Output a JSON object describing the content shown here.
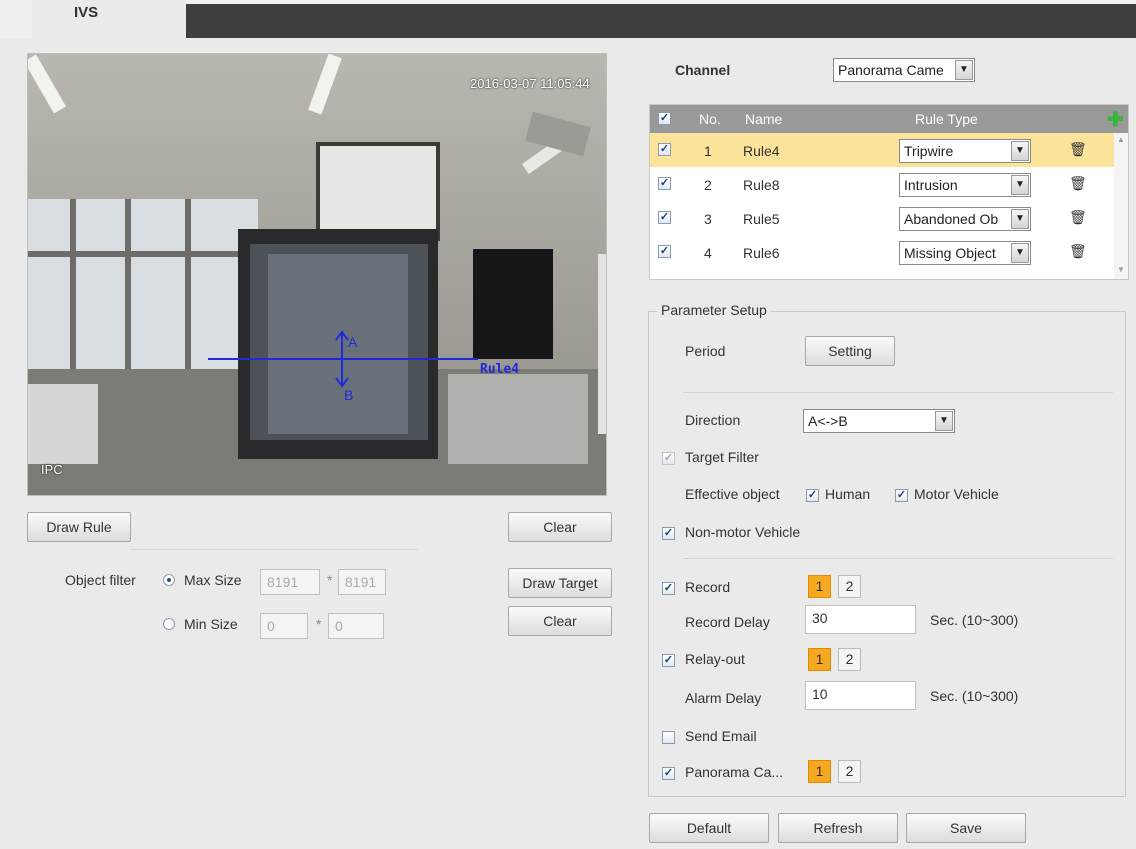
{
  "tab": {
    "label": "IVS"
  },
  "video": {
    "timestamp": "2016-03-07 11:05:44",
    "channel_label": "IPC",
    "rule_overlay_name": "Rule4",
    "direction_a": "A",
    "direction_b": "B"
  },
  "left_controls": {
    "draw_rule": "Draw Rule",
    "clear_rule": "Clear",
    "object_filter_label": "Object filter",
    "max_size_label": "Max Size",
    "max_w": "8191",
    "max_h": "8191",
    "min_size_label": "Min Size",
    "min_w": "0",
    "min_h": "0",
    "times": "*",
    "draw_target": "Draw Target",
    "clear_target": "Clear"
  },
  "channel": {
    "label": "Channel",
    "value": "Panorama Came"
  },
  "rules": {
    "headers": {
      "no": "No.",
      "name": "Name",
      "rule_type": "Rule Type"
    },
    "rows": [
      {
        "no": "1",
        "name": "Rule4",
        "type": "Tripwire",
        "selected": true
      },
      {
        "no": "2",
        "name": "Rule8",
        "type": "Intrusion",
        "selected": false
      },
      {
        "no": "3",
        "name": "Rule5",
        "type": "Abandoned Ob",
        "selected": false
      },
      {
        "no": "4",
        "name": "Rule6",
        "type": "Missing Object",
        "selected": false
      }
    ]
  },
  "params": {
    "legend": "Parameter Setup",
    "period_label": "Period",
    "setting_button": "Setting",
    "direction_label": "Direction",
    "direction_value": "A<->B",
    "target_filter": "Target Filter",
    "effective_object": "Effective object",
    "human": "Human",
    "motor_vehicle": "Motor Vehicle",
    "non_motor_vehicle": "Non-motor Vehicle",
    "record": "Record",
    "record_delay_label": "Record Delay",
    "record_delay": "30",
    "record_delay_range": "Sec. (10~300)",
    "relay_out": "Relay-out",
    "alarm_delay_label": "Alarm Delay",
    "alarm_delay": "10",
    "alarm_delay_range": "Sec. (10~300)",
    "send_email": "Send Email",
    "panorama": "Panorama Ca...",
    "ch1": "1",
    "ch2": "2"
  },
  "footer": {
    "default": "Default",
    "refresh": "Refresh",
    "save": "Save"
  },
  "colors": {
    "accent": "#f6a81e",
    "selected_row": "#fbe39a",
    "rule_line": "#1f2bd8"
  }
}
